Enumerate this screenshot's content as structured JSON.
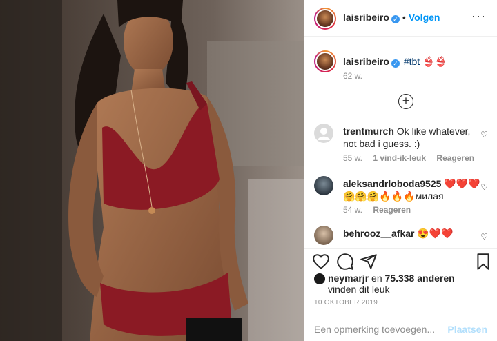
{
  "post": {
    "author": "laisribeiro",
    "follow_label": "Volgen",
    "separator": "•",
    "more_label": "···",
    "caption": {
      "username": "laisribeiro",
      "text": "#tbt 👙👙",
      "time": "62 w."
    }
  },
  "comments": [
    {
      "username": "trentmurch",
      "text": "Ok like whatever, not bad i guess. :)",
      "time": "55 w.",
      "likes": "1 vind-ik-leuk",
      "reply": "Reageren"
    },
    {
      "username": "aleksandrloboda9525",
      "text": "❤️❤️❤️ 🤗🤗🤗🔥🔥🔥милая",
      "time": "54 w.",
      "reply": "Reageren"
    },
    {
      "username": "behrooz__afkar",
      "text": "😍❤️❤️"
    }
  ],
  "likes": {
    "user": "neymarjr",
    "connector": "en",
    "count": "75.338 anderen",
    "suffix": "vinden dit leuk"
  },
  "date": "10 OKTOBER 2019",
  "comment_input": {
    "placeholder": "Een opmerking toevoegen...",
    "post_label": "Plaatsen"
  },
  "icons": {
    "verified": "verified-badge-icon",
    "load_more": "plus-circle-icon",
    "like": "heart-icon",
    "comment": "comment-icon",
    "share": "paper-plane-icon",
    "save": "bookmark-icon"
  },
  "colors": {
    "accent": "#0095f6",
    "verified": "#3897f0",
    "muted": "#8e8e8e",
    "post_disabled": "#b2dffc"
  }
}
